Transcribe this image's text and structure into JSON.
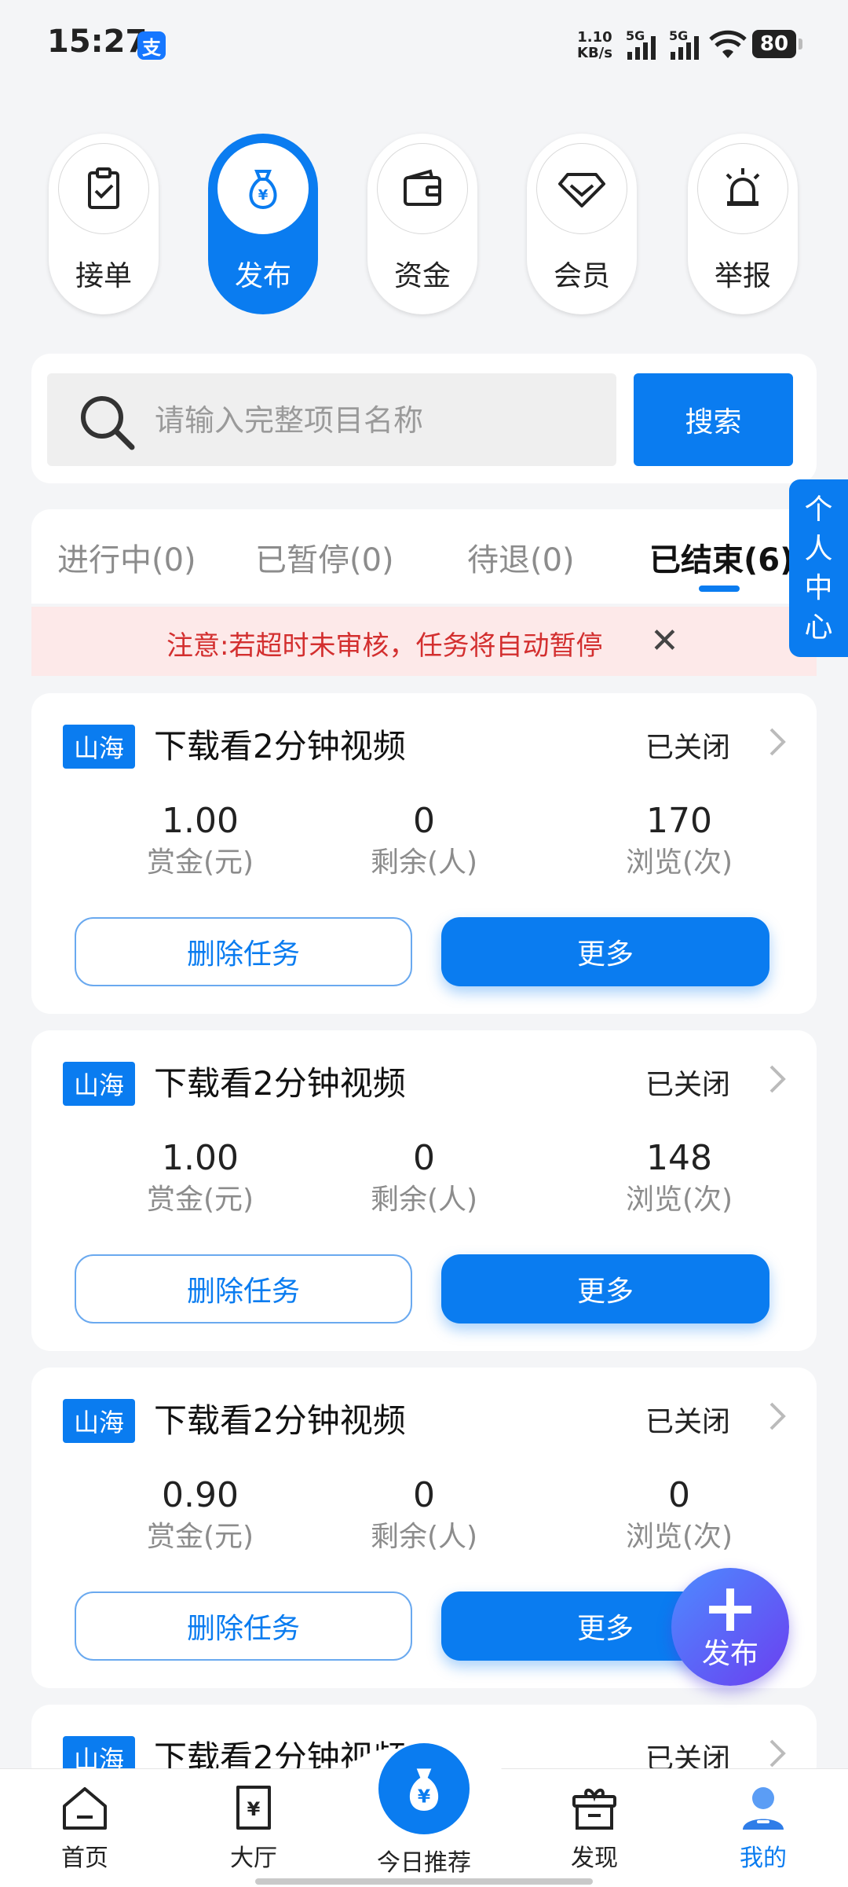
{
  "status_bar": {
    "time": "15:27",
    "alipay_badge": "支",
    "net_speed_value": "1.10",
    "net_speed_unit": "KB/s",
    "signal1_label": "5G",
    "signal2_label": "5G",
    "battery": "80"
  },
  "top_nav": [
    {
      "label": "接单",
      "icon": "clipboard-check-icon"
    },
    {
      "label": "发布",
      "icon": "money-bag-icon"
    },
    {
      "label": "资金",
      "icon": "wallet-icon"
    },
    {
      "label": "会员",
      "icon": "diamond-icon"
    },
    {
      "label": "举报",
      "icon": "alarm-light-icon"
    }
  ],
  "search": {
    "placeholder": "请输入完整项目名称",
    "button_label": "搜索"
  },
  "tabs": [
    {
      "label": "进行中(0)"
    },
    {
      "label": "已暂停(0)"
    },
    {
      "label": "待退(0)"
    },
    {
      "label": "已结束(6)"
    }
  ],
  "notice": {
    "text": "注意:若超时未审核，任务将自动暂停",
    "close": "✕"
  },
  "side_tab": {
    "line1": "个",
    "line2": "人",
    "line3": "中",
    "line4": "心"
  },
  "tasks": [
    {
      "badge": "山海",
      "title": "下载看2分钟视频",
      "status": "已关闭",
      "reward": "1.00",
      "reward_label": "赏金(元)",
      "remaining": "0",
      "remaining_label": "剩余(人)",
      "views": "170",
      "views_label": "浏览(次)",
      "delete_label": "删除任务",
      "more_label": "更多"
    },
    {
      "badge": "山海",
      "title": "下载看2分钟视频",
      "status": "已关闭",
      "reward": "1.00",
      "reward_label": "赏金(元)",
      "remaining": "0",
      "remaining_label": "剩余(人)",
      "views": "148",
      "views_label": "浏览(次)",
      "delete_label": "删除任务",
      "more_label": "更多"
    },
    {
      "badge": "山海",
      "title": "下载看2分钟视频",
      "status": "已关闭",
      "reward": "0.90",
      "reward_label": "赏金(元)",
      "remaining": "0",
      "remaining_label": "剩余(人)",
      "views": "0",
      "views_label": "浏览(次)",
      "delete_label": "删除任务",
      "more_label": "更多"
    },
    {
      "badge": "山海",
      "title": "下载看2分钟视频",
      "status": "已关闭"
    }
  ],
  "fab": {
    "plus": "+",
    "label": "发布"
  },
  "bottom_nav": {
    "home": "首页",
    "hall": "大厅",
    "today": "今日推荐",
    "discover": "发现",
    "mine": "我的"
  },
  "colors": {
    "accent": "#0a7cf0",
    "notice_bg": "#fde9e9",
    "notice_text": "#d32f2f"
  }
}
